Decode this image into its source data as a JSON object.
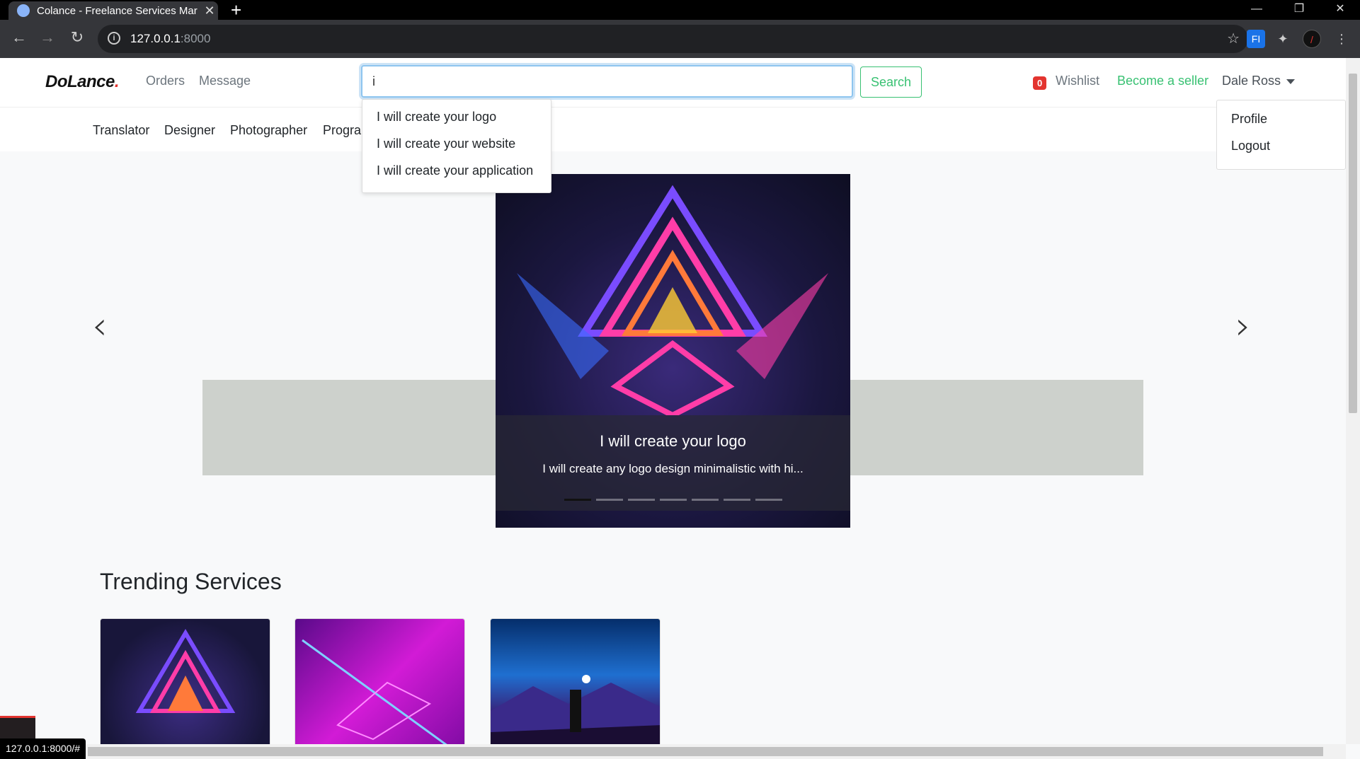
{
  "browser": {
    "tab_title": "Colance - Freelance Services Mar",
    "url_host": "127.0.0.1",
    "url_port": ":8000",
    "status_url": "127.0.0.1:8000/#"
  },
  "nav": {
    "logo": "DoLance",
    "logo_dot": ".",
    "links": [
      "Orders",
      "Message"
    ],
    "search_value": "i",
    "search_button": "Search",
    "wishlist_count": "0",
    "wishlist_label": "Wishlist",
    "seller_label": "Become a seller",
    "user_name": "Dale Ross"
  },
  "categories": [
    "Translator",
    "Designer",
    "Photographer",
    "Program"
  ],
  "autocomplete": [
    "I will create your logo",
    "I will create your website",
    "I will create your application"
  ],
  "user_menu": [
    "Profile",
    "Logout"
  ],
  "carousel": {
    "title": "I will create your logo",
    "text": "I will create any logo design minimalistic with hi...",
    "indicator_count": 7,
    "active_index": 0,
    "prev_icon": "chevron-left-icon",
    "next_icon": "chevron-right-icon"
  },
  "trending": {
    "heading": "Trending Services"
  },
  "colors": {
    "accent_green": "#38c172",
    "badge_red": "#e3342f"
  }
}
